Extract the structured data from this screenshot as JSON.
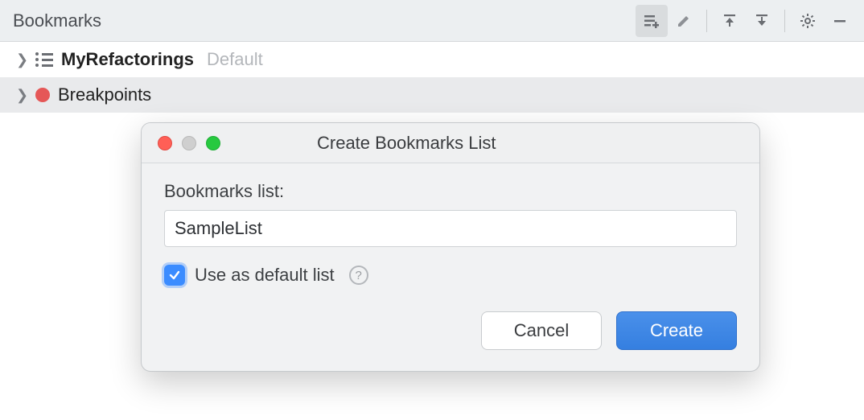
{
  "panel": {
    "title": "Bookmarks"
  },
  "toolbar": {
    "items": [
      {
        "name": "new-list-icon",
        "interactable": true,
        "active": true
      },
      {
        "name": "edit-icon",
        "interactable": true,
        "active": false
      },
      {
        "sep": true
      },
      {
        "name": "collapse-icon",
        "interactable": true,
        "active": false
      },
      {
        "name": "expand-icon",
        "interactable": true,
        "active": false
      },
      {
        "sep": true
      },
      {
        "name": "settings-icon",
        "interactable": true,
        "active": false
      },
      {
        "name": "minimize-icon",
        "interactable": true,
        "active": false
      }
    ]
  },
  "tree": {
    "rows": [
      {
        "kind": "list",
        "label": "MyRefactorings",
        "suffix": "Default",
        "selected": false
      },
      {
        "kind": "breakpoints",
        "label": "Breakpoints",
        "suffix": "",
        "selected": true
      }
    ]
  },
  "dialog": {
    "title": "Create Bookmarks List",
    "field_label": "Bookmarks list:",
    "input_value": "SampleList",
    "checkbox_label": "Use as default list",
    "checkbox_checked": true,
    "cancel_label": "Cancel",
    "create_label": "Create"
  }
}
